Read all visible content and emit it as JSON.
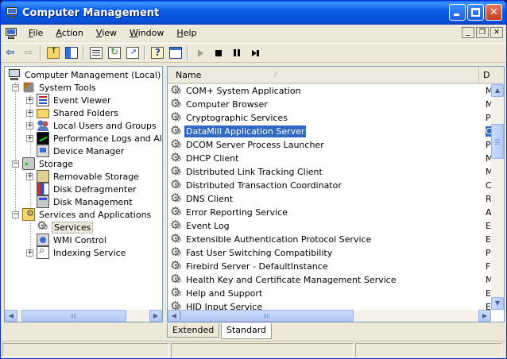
{
  "window": {
    "title": "Computer Management"
  },
  "menu": {
    "items": [
      {
        "label": "File",
        "key": "F",
        "rest": "ile"
      },
      {
        "label": "Action",
        "key": "A",
        "rest": "ction"
      },
      {
        "label": "View",
        "key": "V",
        "rest": "iew"
      },
      {
        "label": "Window",
        "key": "W",
        "rest": "indow"
      },
      {
        "label": "Help",
        "key": "H",
        "rest": "elp"
      }
    ]
  },
  "tree": {
    "root": "Computer Management (Local)",
    "system_tools": "System Tools",
    "event_viewer": "Event Viewer",
    "shared_folders": "Shared Folders",
    "local_users": "Local Users and Groups",
    "performance": "Performance Logs and Alerts",
    "device_manager": "Device Manager",
    "storage": "Storage",
    "removable_storage": "Removable Storage",
    "disk_defrag": "Disk Defragmenter",
    "disk_management": "Disk Management",
    "services_apps": "Services and Applications",
    "services": "Services",
    "wmi": "WMI Control",
    "indexing": "Indexing Service"
  },
  "list": {
    "col_name": "Name",
    "col_desc": "D",
    "sort_indicator": "/",
    "rows": [
      {
        "name": "COM+ System Application",
        "desc": "M"
      },
      {
        "name": "Computer Browser",
        "desc": "M"
      },
      {
        "name": "Cryptographic Services",
        "desc": "P"
      },
      {
        "name": "DataMill Application Server",
        "desc": "C",
        "selected": true
      },
      {
        "name": "DCOM Server Process Launcher",
        "desc": "P"
      },
      {
        "name": "DHCP Client",
        "desc": "M"
      },
      {
        "name": "Distributed Link Tracking Client",
        "desc": "M"
      },
      {
        "name": "Distributed Transaction Coordinator",
        "desc": "C"
      },
      {
        "name": "DNS Client",
        "desc": "R"
      },
      {
        "name": "Error Reporting Service",
        "desc": "A"
      },
      {
        "name": "Event Log",
        "desc": "E"
      },
      {
        "name": "Extensible Authentication Protocol Service",
        "desc": "E"
      },
      {
        "name": "Fast User Switching Compatibility",
        "desc": "P"
      },
      {
        "name": "Firebird Server - DefaultInstance",
        "desc": "F"
      },
      {
        "name": "Health Key and Certificate Management Service",
        "desc": "M"
      },
      {
        "name": "Help and Support",
        "desc": "E"
      },
      {
        "name": "HID Input Service",
        "desc": "E"
      }
    ]
  },
  "tabs": {
    "extended": "Extended",
    "standard": "Standard"
  },
  "colors": {
    "selection": "#316ac5",
    "titlebar": "#0b5ce6",
    "chrome": "#ece9d8"
  }
}
